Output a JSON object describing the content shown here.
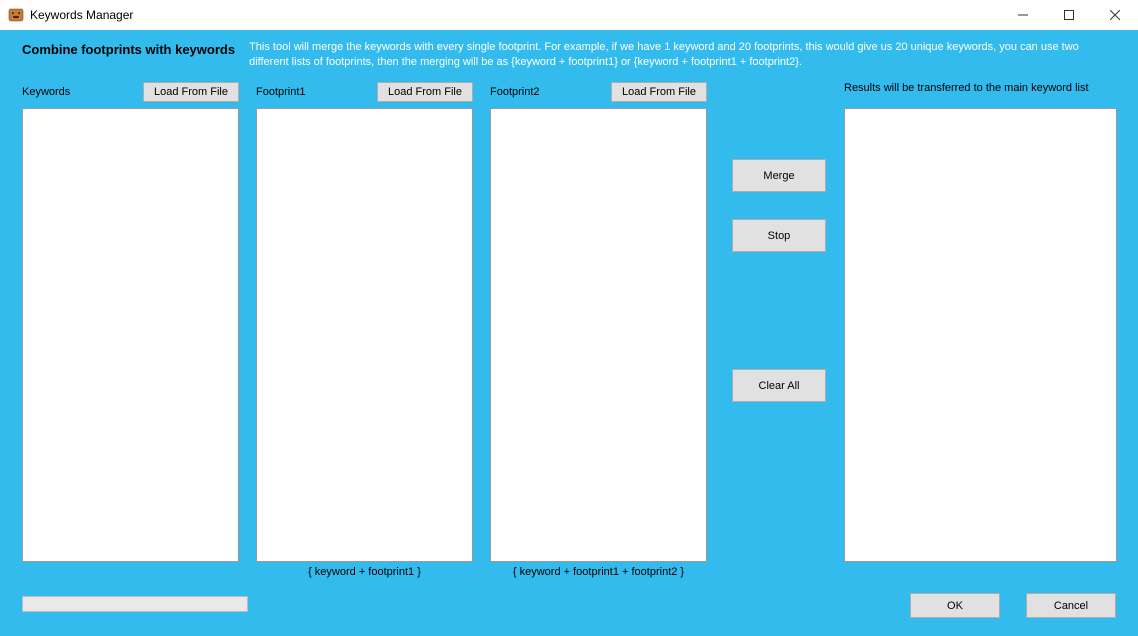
{
  "window": {
    "title": "Keywords Manager"
  },
  "header": {
    "title": "Combine footprints with keywords",
    "description": "This tool will merge the keywords with every single footprint. For example, if we have 1 keyword and 20 footprints, this would give us 20 unique keywords, you can use two different lists of footprints, then the merging will be as {keyword + footprint1} or {keyword + footprint1 + footprint2}."
  },
  "columns": {
    "keywords": {
      "label": "Keywords",
      "load_label": "Load From File",
      "value": ""
    },
    "footprint1": {
      "label": "Footprint1",
      "load_label": "Load From File",
      "value": "",
      "subcaption": "{ keyword + footprint1 }"
    },
    "footprint2": {
      "label": "Footprint2",
      "load_label": "Load From File",
      "value": "",
      "subcaption": "{ keyword + footprint1 + footprint2 }"
    }
  },
  "actions": {
    "merge": "Merge",
    "stop": "Stop",
    "clear_all": "Clear All"
  },
  "results": {
    "label": "Results will be transferred to the main keyword list",
    "value": ""
  },
  "footer": {
    "ok": "OK",
    "cancel": "Cancel"
  }
}
